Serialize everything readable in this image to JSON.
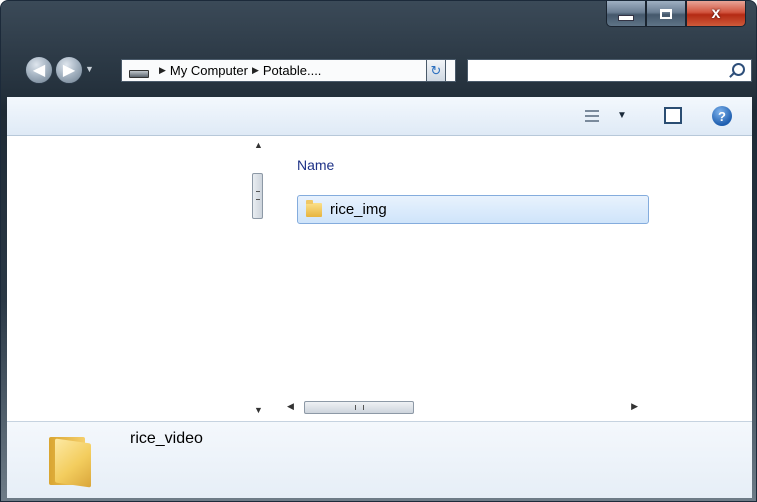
{
  "window": {
    "caption_buttons": {
      "minimize_icon": "minimize-icon",
      "maximize_icon": "maximize-icon",
      "close_icon": "close-icon",
      "close_glyph": "x"
    }
  },
  "navigation": {
    "back_icon": "back-arrow-icon",
    "forward_icon": "forward-arrow-icon",
    "breadcrumbs": [
      "My Computer",
      "Potable...."
    ],
    "search": {
      "value": "",
      "placeholder": ""
    }
  },
  "command_bar": {
    "views_icon": "views-icon",
    "preview_pane_icon": "preview-pane-icon",
    "help_icon": "help-icon",
    "help_glyph": "?"
  },
  "file_list": {
    "columns": [
      "Name"
    ],
    "items": [
      {
        "name": "rice_img",
        "icon": "folder-icon",
        "selected": true
      }
    ]
  },
  "details_pane": {
    "name": "rice_video",
    "icon": "folder-icon"
  },
  "colors": {
    "selection_fill": "#cfe4fa",
    "selection_border": "#84acdd",
    "header_text": "#1e3287",
    "close_button": "#c9452c"
  }
}
